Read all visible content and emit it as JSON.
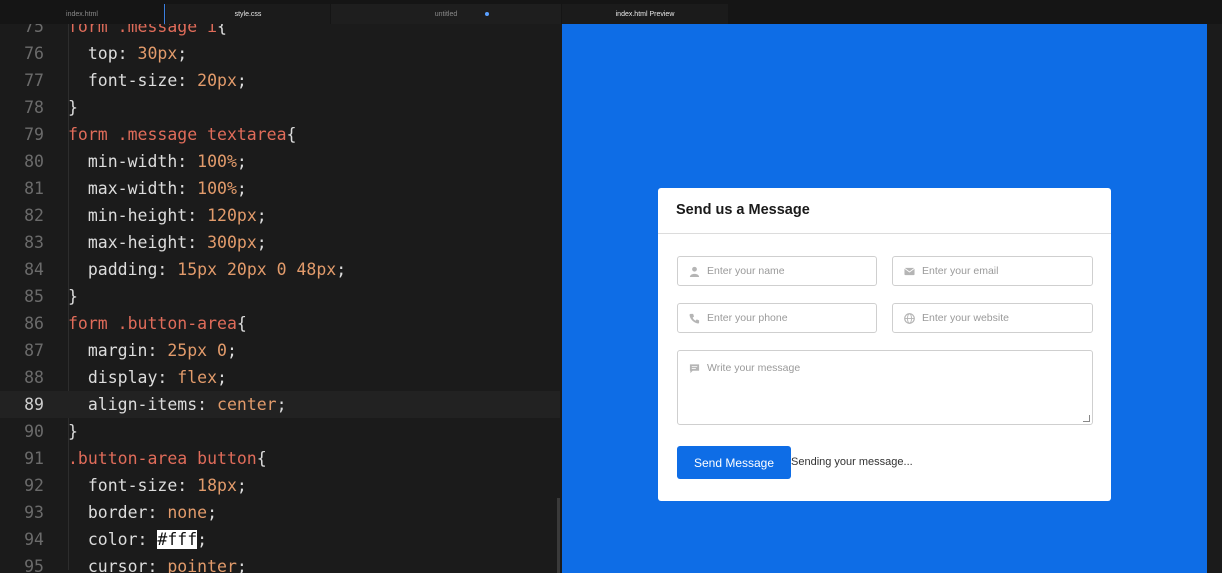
{
  "tabs": [
    {
      "label": "index.html"
    },
    {
      "label": "style.css"
    },
    {
      "label": "untitled"
    },
    {
      "label": "index.html Preview"
    }
  ],
  "editor": {
    "active_line": "89",
    "lines": [
      {
        "n": "75",
        "code": "form .message i{"
      },
      {
        "n": "76",
        "code": "  top: 30px;"
      },
      {
        "n": "77",
        "code": "  font-size: 20px;"
      },
      {
        "n": "78",
        "code": "}"
      },
      {
        "n": "79",
        "code": "form .message textarea{"
      },
      {
        "n": "80",
        "code": "  min-width: 100%;"
      },
      {
        "n": "81",
        "code": "  max-width: 100%;"
      },
      {
        "n": "82",
        "code": "  min-height: 120px;"
      },
      {
        "n": "83",
        "code": "  max-height: 300px;"
      },
      {
        "n": "84",
        "code": "  padding: 15px 20px 0 48px;"
      },
      {
        "n": "85",
        "code": "}"
      },
      {
        "n": "86",
        "code": "form .button-area{"
      },
      {
        "n": "87",
        "code": "  margin: 25px 0;"
      },
      {
        "n": "88",
        "code": "  display: flex;"
      },
      {
        "n": "89",
        "code": "  align-items: center;"
      },
      {
        "n": "90",
        "code": "}"
      },
      {
        "n": "91",
        "code": ".button-area button{"
      },
      {
        "n": "92",
        "code": "  font-size: 18px;"
      },
      {
        "n": "93",
        "code": "  border: none;"
      },
      {
        "n": "94",
        "code": "  color: #fff;"
      },
      {
        "n": "95",
        "code": "  cursor: pointer;"
      }
    ]
  },
  "preview": {
    "title": "Send us a Message",
    "name_placeholder": "Enter your name",
    "email_placeholder": "Enter your email",
    "phone_placeholder": "Enter your phone",
    "website_placeholder": "Enter your website",
    "message_placeholder": "Write your message",
    "button_label": "Send Message",
    "status_text": "Sending your message...",
    "accent": "#0e6de6"
  }
}
